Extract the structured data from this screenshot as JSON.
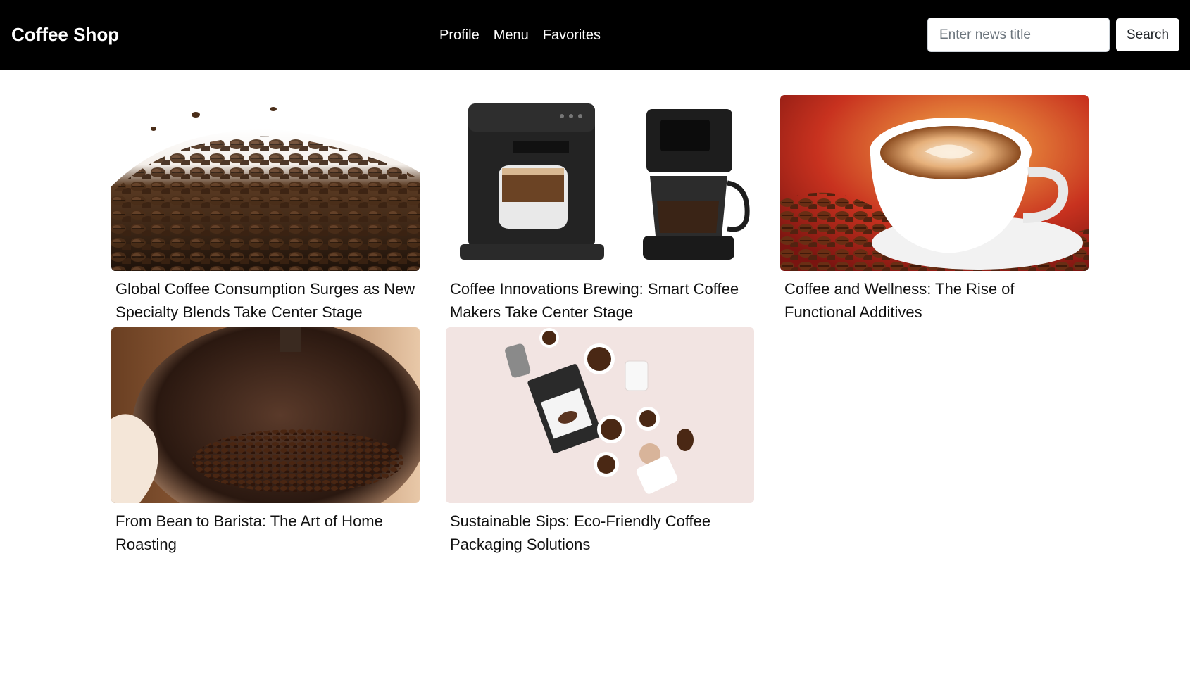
{
  "navbar": {
    "brand": "Coffee Shop",
    "links": [
      "Profile",
      "Menu",
      "Favorites"
    ],
    "search": {
      "placeholder": "Enter news title",
      "value": "",
      "button_label": "Search"
    }
  },
  "articles": [
    {
      "title": "Global Coffee Consumption Surges as New Specialty Blends Take Center Stage",
      "image": "coffee-beans-pile"
    },
    {
      "title": "Coffee Innovations Brewing: Smart Coffee Makers Take Center Stage",
      "image": "coffee-machines"
    },
    {
      "title": "Coffee and Wellness: The Rise of Functional Additives",
      "image": "latte-cup"
    },
    {
      "title": "From Bean to Barista: The Art of Home Roasting",
      "image": "roasting-drum"
    },
    {
      "title": "Sustainable Sips: Eco-Friendly Coffee Packaging Solutions",
      "image": "coffee-packaging-flatlay"
    }
  ],
  "colors": {
    "navbar": "#000000",
    "background": "#ffffff"
  }
}
